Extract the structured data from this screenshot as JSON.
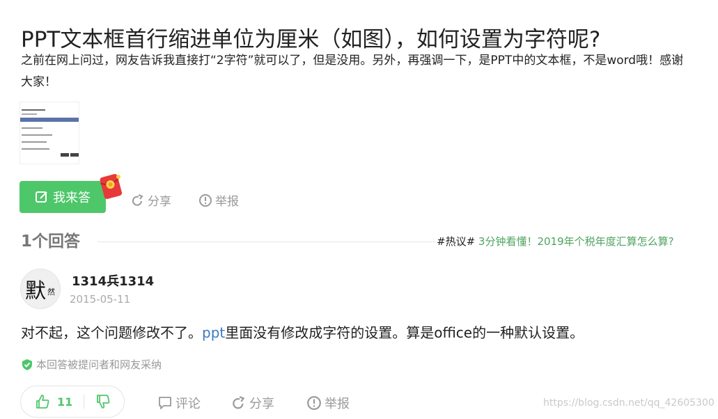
{
  "question": {
    "title": "PPT文本框首行缩进单位为厘米（如图），如何设置为字符呢?",
    "description": "之前在网上问过，网友告诉我直接打“2字符”就可以了，但是没用。另外，再强调一下，是PPT中的文本框，不是word哦！感谢大家！"
  },
  "actions": {
    "answer_label": "我来答",
    "share_label": "分享",
    "report_label": "举报"
  },
  "answers_section": {
    "count_label": "1个回答",
    "hot_tag": "#热议#",
    "hot_link": "3分钟看懂！2019年个税年度汇算怎么算?"
  },
  "answer": {
    "avatar_char_big": "默",
    "avatar_char_small": "然",
    "username": "1314兵1314",
    "date": "2015-05-11",
    "text_before": "对不起，这个问题修改不了。",
    "text_highlight": "ppt",
    "text_after": "里面没有修改成字符的设置。算是office的一种默认设置。",
    "adopted_label": "本回答被提问者和网友采纳",
    "like_count": "11",
    "comment_label": "评论",
    "share_label": "分享",
    "report_label": "举报"
  },
  "watermark": "https://blog.csdn.net/qq_42605300",
  "colors": {
    "accent_green": "#4ec76a",
    "link_green": "#4ea35e",
    "link_blue": "#3b7bbf",
    "muted": "#999999"
  }
}
